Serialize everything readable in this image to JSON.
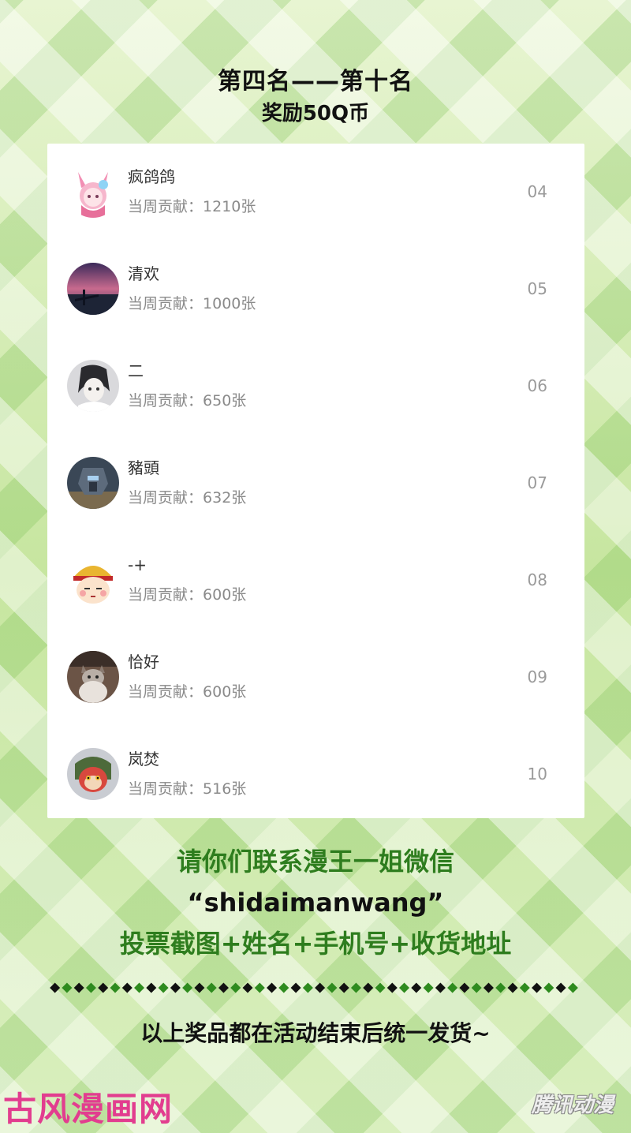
{
  "header": {
    "title": "第四名——第十名",
    "subtitle": "奖励50Q币"
  },
  "leaderboard": [
    {
      "name": "疯鸽鸽",
      "label": "当周贡献：",
      "count": "1210张",
      "rank": "04",
      "avatar_icon": "pink-bunny-girl-avatar-icon"
    },
    {
      "name": "清欢",
      "label": "当周贡献：",
      "count": "1000张",
      "rank": "05",
      "avatar_icon": "sunset-scene-avatar-icon"
    },
    {
      "name": "二",
      "label": "当周贡献：",
      "count": "650张",
      "rank": "06",
      "avatar_icon": "sketch-girl-avatar-icon"
    },
    {
      "name": "豬頭",
      "label": "当周贡献：",
      "count": "632张",
      "rank": "07",
      "avatar_icon": "mecha-robot-avatar-icon"
    },
    {
      "name": "-+",
      "label": "当周贡献：",
      "count": "600张",
      "rank": "08",
      "avatar_icon": "monk-cartoon-avatar-icon"
    },
    {
      "name": "恰好",
      "label": "当周贡献：",
      "count": "600张",
      "rank": "09",
      "avatar_icon": "cat-photo-avatar-icon"
    },
    {
      "name": "岚焚",
      "label": "当周贡献：",
      "count": "516张",
      "rank": "10",
      "avatar_icon": "monkey-king-avatar-icon"
    }
  ],
  "contact": {
    "line1": "请你们联系漫王一姐微信",
    "wechat": "“shidaimanwang”",
    "line3": "投票截图+姓名+手机号+收货地址"
  },
  "notice": "以上奖品都在活动结束后统一发货~",
  "watermarks": {
    "left": "古风漫画网",
    "right": "腾讯动漫"
  },
  "colors": {
    "accent_green": "#2e7d1e",
    "watermark_pink": "#e23d8f",
    "divider_green": "#2e8b1e",
    "divider_dark": "#111111"
  }
}
